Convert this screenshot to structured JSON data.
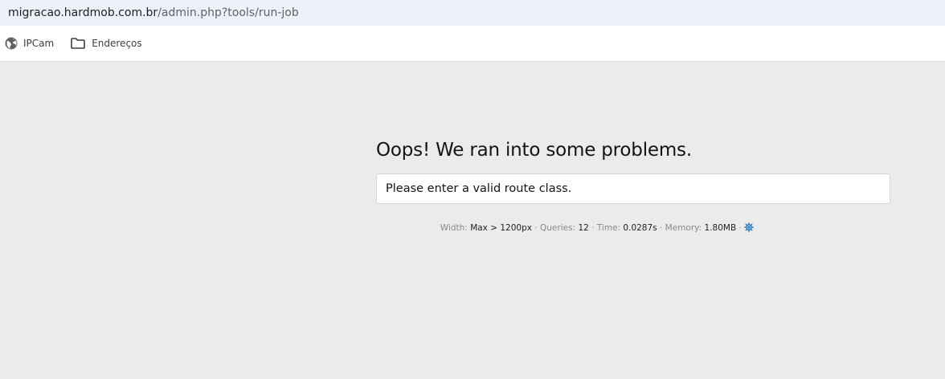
{
  "browser": {
    "url_host": "migracao.hardmob.com.br",
    "url_path": "/admin.php?tools/run-job"
  },
  "bookmarks": [
    {
      "label": "IPCam",
      "icon": "globe-icon"
    },
    {
      "label": "Endereços",
      "icon": "folder-icon"
    }
  ],
  "error": {
    "title": "Oops! We ran into some problems.",
    "message": "Please enter a valid route class."
  },
  "debug": {
    "width_label": "Width:",
    "width_value": "Max > 1200px",
    "queries_label": "Queries:",
    "queries_value": "12",
    "time_label": "Time:",
    "time_value": "0.0287s",
    "memory_label": "Memory:",
    "memory_value": "1.80MB",
    "separator": "·",
    "settings_icon": "gear-icon",
    "accent_color": "#2d7bc0"
  }
}
